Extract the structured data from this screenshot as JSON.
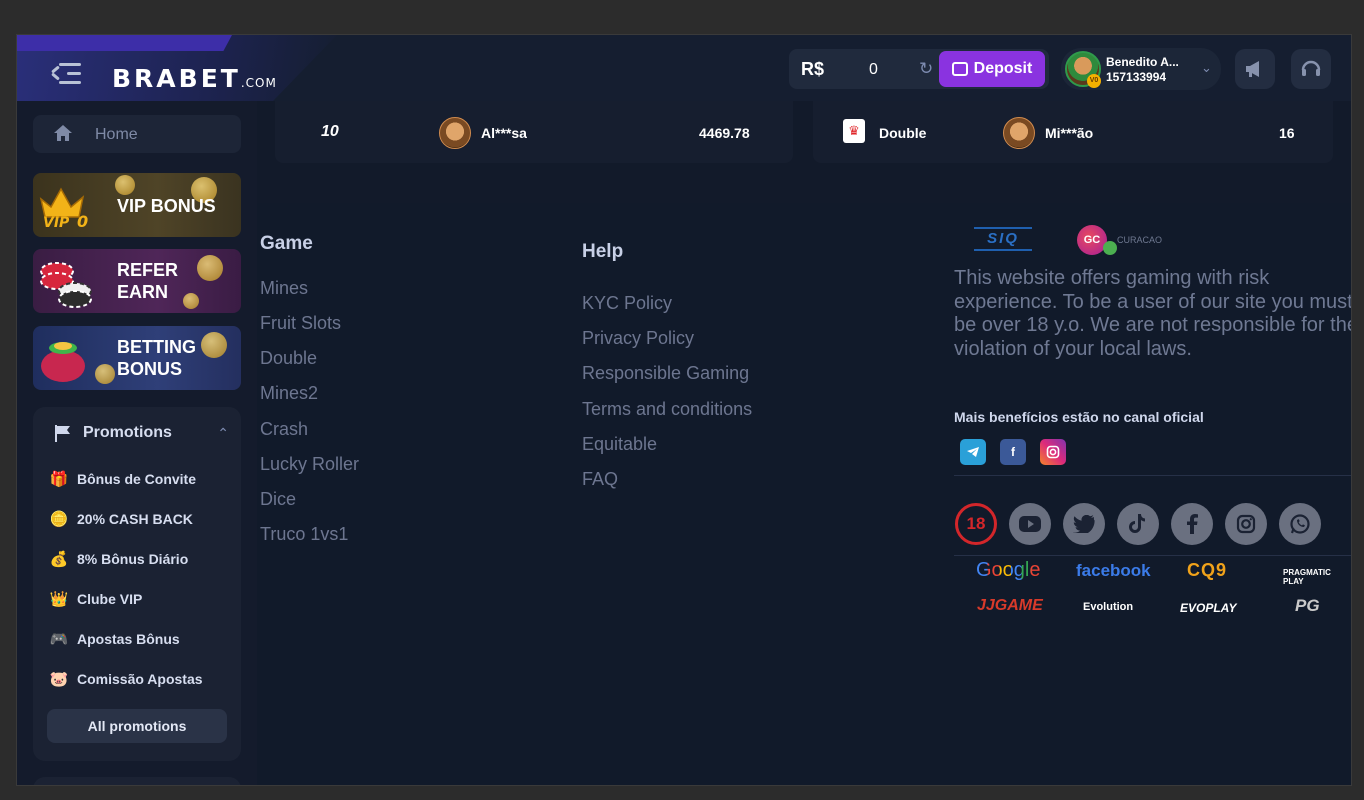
{
  "header": {
    "logo_main": "BRABET",
    "logo_suffix": ".COM",
    "currency": "R$",
    "balance": "0",
    "deposit_label": "Deposit",
    "user_name": "Benedito A...",
    "user_id": "157133994"
  },
  "sidebar": {
    "home_label": "Home",
    "banners": [
      {
        "line1": "VIP BONUS",
        "line2": ""
      },
      {
        "line1": "REFER",
        "line2": "EARN"
      },
      {
        "line1": "BETTING",
        "line2": "BONUS"
      }
    ],
    "promotions_title": "Promotions",
    "promotion_items": [
      {
        "label": "Bônus de Convite",
        "icon": "gift-icon"
      },
      {
        "label": "20% CASH BACK",
        "icon": "coins-icon"
      },
      {
        "label": "8% Bônus Diário",
        "icon": "money-bag-icon"
      },
      {
        "label": "Clube VIP",
        "icon": "crown-icon"
      },
      {
        "label": "Apostas Bônus",
        "icon": "gamepad-icon"
      },
      {
        "label": "Comissão Apostas",
        "icon": "piggy-bank-icon"
      }
    ],
    "all_promotions_label": "All promotions"
  },
  "recent_bets": {
    "left": {
      "multiplier": "10",
      "player": "Al***sa",
      "amount": "4469.78"
    },
    "right": {
      "game": "Double",
      "player": "Mi***ão",
      "amount": "16"
    }
  },
  "footer": {
    "game_title": "Game",
    "game_links": [
      "Mines",
      "Fruit Slots",
      "Double",
      "Mines2",
      "Crash",
      "Lucky Roller",
      "Dice",
      "Truco 1vs1"
    ],
    "help_title": "Help",
    "help_links": [
      "KYC Policy",
      "Privacy Policy",
      "Responsible Gaming",
      "Terms and conditions",
      "Equitable",
      "FAQ"
    ],
    "siq_label": "SIQ",
    "gc_label": "GC",
    "gc_text": "CURACAO",
    "disclaimer": "This website offers gaming with risk experience. To be a user of our site you must be over 18 y.o. We are not responsible for the violation of your local laws.",
    "channel_text": "Mais benefícios estão no canal oficial",
    "age_label": "18",
    "partners": [
      "Google",
      "facebook",
      "CQ9",
      "PRAGMATIC PLAY",
      "JJGAME",
      "Evolution",
      "EVOPLAY",
      "PG"
    ]
  },
  "colors": {
    "background": "#0f1627",
    "accent_purple": "#8a33e0",
    "logo_accent": "#f4b11d",
    "age_red": "#d3262a"
  }
}
